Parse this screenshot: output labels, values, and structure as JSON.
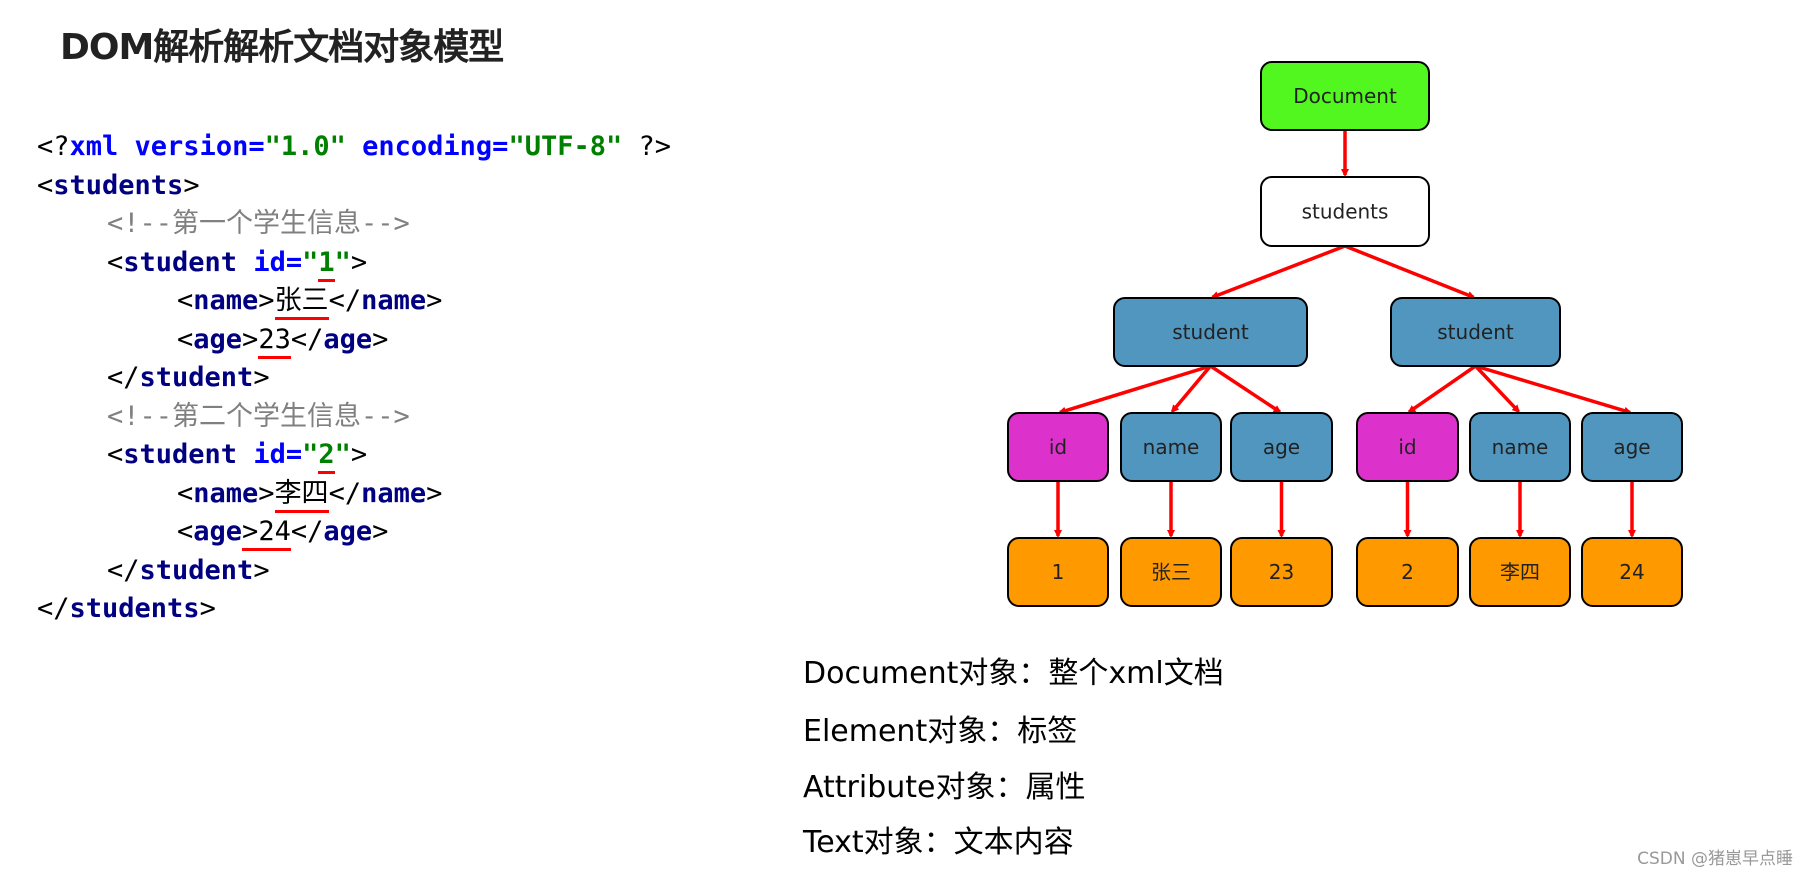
{
  "title": "DOM解析解析文档对象模型",
  "code": {
    "lines": [
      {
        "indent": 0,
        "parts": [
          {
            "c": "punc",
            "t": "<?"
          },
          {
            "c": "attr",
            "t": "xml version="
          },
          {
            "c": "str",
            "t": "\"1.0\""
          },
          {
            "c": "attr",
            "t": " encoding="
          },
          {
            "c": "str",
            "t": "\"UTF-8\""
          },
          {
            "c": "punc",
            "t": " ?>"
          }
        ]
      },
      {
        "indent": 0,
        "parts": [
          {
            "c": "punc",
            "t": "<"
          },
          {
            "c": "tag",
            "t": "students"
          },
          {
            "c": "punc",
            "t": ">"
          }
        ]
      },
      {
        "indent": 1,
        "parts": [
          {
            "c": "cmt",
            "t": "<!--第一个学生信息-->"
          }
        ]
      },
      {
        "indent": 1,
        "parts": [
          {
            "c": "punc",
            "t": "<"
          },
          {
            "c": "tag",
            "t": "student "
          },
          {
            "c": "attr",
            "t": "id="
          },
          {
            "c": "str",
            "t": "\""
          },
          {
            "c": "str ul",
            "t": "1"
          },
          {
            "c": "str",
            "t": "\""
          },
          {
            "c": "punc",
            "t": ">"
          }
        ]
      },
      {
        "indent": 2,
        "parts": [
          {
            "c": "punc",
            "t": "<"
          },
          {
            "c": "tag",
            "t": "name"
          },
          {
            "c": "punc",
            "t": ">"
          },
          {
            "c": "txt ul",
            "t": "张三"
          },
          {
            "c": "punc",
            "t": "</"
          },
          {
            "c": "tag",
            "t": "name"
          },
          {
            "c": "punc",
            "t": ">"
          }
        ]
      },
      {
        "indent": 2,
        "parts": [
          {
            "c": "punc",
            "t": "<"
          },
          {
            "c": "tag",
            "t": "age"
          },
          {
            "c": "punc",
            "t": ">"
          },
          {
            "c": "txt ul",
            "t": "23"
          },
          {
            "c": "punc",
            "t": "</"
          },
          {
            "c": "tag",
            "t": "age"
          },
          {
            "c": "punc",
            "t": ">"
          }
        ]
      },
      {
        "indent": 1,
        "parts": [
          {
            "c": "punc",
            "t": "</"
          },
          {
            "c": "tag",
            "t": "student"
          },
          {
            "c": "punc",
            "t": ">"
          }
        ]
      },
      {
        "indent": 1,
        "parts": [
          {
            "c": "cmt",
            "t": "<!--第二个学生信息-->"
          }
        ]
      },
      {
        "indent": 1,
        "parts": [
          {
            "c": "punc",
            "t": "<"
          },
          {
            "c": "tag",
            "t": "student "
          },
          {
            "c": "attr",
            "t": "id="
          },
          {
            "c": "str",
            "t": "\""
          },
          {
            "c": "str ul",
            "t": "2"
          },
          {
            "c": "str",
            "t": "\""
          },
          {
            "c": "punc",
            "t": ">"
          }
        ]
      },
      {
        "indent": 2,
        "parts": [
          {
            "c": "punc",
            "t": "<"
          },
          {
            "c": "tag",
            "t": "name"
          },
          {
            "c": "punc",
            "t": ">"
          },
          {
            "c": "txt ul",
            "t": "李四"
          },
          {
            "c": "punc",
            "t": "</"
          },
          {
            "c": "tag",
            "t": "name"
          },
          {
            "c": "punc",
            "t": ">"
          }
        ]
      },
      {
        "indent": 2,
        "parts": [
          {
            "c": "punc",
            "t": "<"
          },
          {
            "c": "tag",
            "t": "age"
          },
          {
            "c": "punc ul",
            "t": ">"
          },
          {
            "c": "txt ul",
            "t": "24"
          },
          {
            "c": "punc",
            "t": "</"
          },
          {
            "c": "tag",
            "t": "age"
          },
          {
            "c": "punc",
            "t": ">"
          }
        ]
      },
      {
        "indent": 1,
        "parts": [
          {
            "c": "punc",
            "t": "</"
          },
          {
            "c": "tag",
            "t": "student"
          },
          {
            "c": "punc",
            "t": ">"
          }
        ]
      },
      {
        "indent": 0,
        "parts": [
          {
            "c": "punc",
            "t": "</"
          },
          {
            "c": "tag",
            "t": "students"
          },
          {
            "c": "punc",
            "t": ">"
          }
        ]
      }
    ]
  },
  "colors": {
    "document": "#52f71f",
    "element_root": "#ffffff",
    "element": "#5096bf",
    "attribute": "#dc32cb",
    "text": "#ff9900",
    "arrow": "#ff0000",
    "border": "#000000"
  },
  "tree": {
    "nodes": [
      {
        "id": "document",
        "label": "Document",
        "kind": "document"
      },
      {
        "id": "students",
        "label": "students",
        "kind": "element_root"
      },
      {
        "id": "student1",
        "label": "student",
        "kind": "element"
      },
      {
        "id": "student2",
        "label": "student",
        "kind": "element"
      },
      {
        "id": "id1",
        "label": "id",
        "kind": "attribute"
      },
      {
        "id": "name1",
        "label": "name",
        "kind": "element"
      },
      {
        "id": "age1",
        "label": "age",
        "kind": "element"
      },
      {
        "id": "id2",
        "label": "id",
        "kind": "attribute"
      },
      {
        "id": "name2",
        "label": "name",
        "kind": "element"
      },
      {
        "id": "age2",
        "label": "age",
        "kind": "element"
      },
      {
        "id": "v_id1",
        "label": "1",
        "kind": "text"
      },
      {
        "id": "v_name1",
        "label": "张三",
        "kind": "text"
      },
      {
        "id": "v_age1",
        "label": "23",
        "kind": "text"
      },
      {
        "id": "v_id2",
        "label": "2",
        "kind": "text"
      },
      {
        "id": "v_name2",
        "label": "李四",
        "kind": "text"
      },
      {
        "id": "v_age2",
        "label": "24",
        "kind": "text"
      }
    ],
    "edges": [
      [
        "document",
        "students"
      ],
      [
        "students",
        "student1"
      ],
      [
        "students",
        "student2"
      ],
      [
        "student1",
        "id1"
      ],
      [
        "student1",
        "name1"
      ],
      [
        "student1",
        "age1"
      ],
      [
        "student2",
        "id2"
      ],
      [
        "student2",
        "name2"
      ],
      [
        "student2",
        "age2"
      ],
      [
        "id1",
        "v_id1"
      ],
      [
        "name1",
        "v_name1"
      ],
      [
        "age1",
        "v_age1"
      ],
      [
        "id2",
        "v_id2"
      ],
      [
        "name2",
        "v_name2"
      ],
      [
        "age2",
        "v_age2"
      ]
    ]
  },
  "legend": [
    "Document对象：整个xml文档",
    "Element对象：标签",
    "Attribute对象：属性",
    "Text对象：文本内容"
  ],
  "watermark": "CSDN @猪崽早点睡"
}
